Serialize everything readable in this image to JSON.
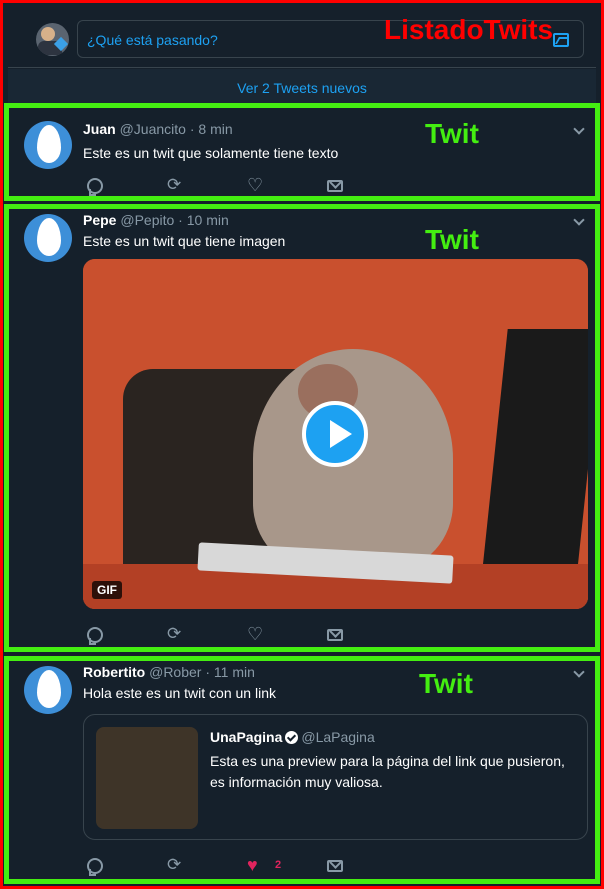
{
  "annotations": {
    "list_label": "ListadoTwits",
    "tweet_label": "Twit"
  },
  "compose": {
    "placeholder": "¿Qué está pasando?",
    "icon": "image-icon"
  },
  "new_tweets": "Ver 2 Tweets nuevos",
  "tweets": [
    {
      "name": "Juan",
      "handle": "@Juancito",
      "dot": "·",
      "time": "8 min",
      "text": "Este es un twit que solamente tiene texto",
      "likes": ""
    },
    {
      "name": "Pepe",
      "handle": "@Pepito",
      "dot": "·",
      "time": "10 min",
      "text": "Este es un twit que tiene imagen",
      "media_badge": "GIF",
      "likes": ""
    },
    {
      "name": "Robertito",
      "handle": "@Rober",
      "dot": "·",
      "time": "11 min",
      "text": "Hola este es un twit con un link",
      "card": {
        "name": "UnaPagina",
        "handle": "@LaPagina",
        "description": "Esta es una preview para la página del link que pusieron, es información muy valiosa."
      },
      "likes": "2",
      "liked": true
    }
  ],
  "colors": {
    "background": "#15202b",
    "accent": "#1da1f2",
    "muted": "#8899a6",
    "like": "#e0245e",
    "annotation_red": "#ff0000",
    "annotation_green": "#44ee11"
  }
}
